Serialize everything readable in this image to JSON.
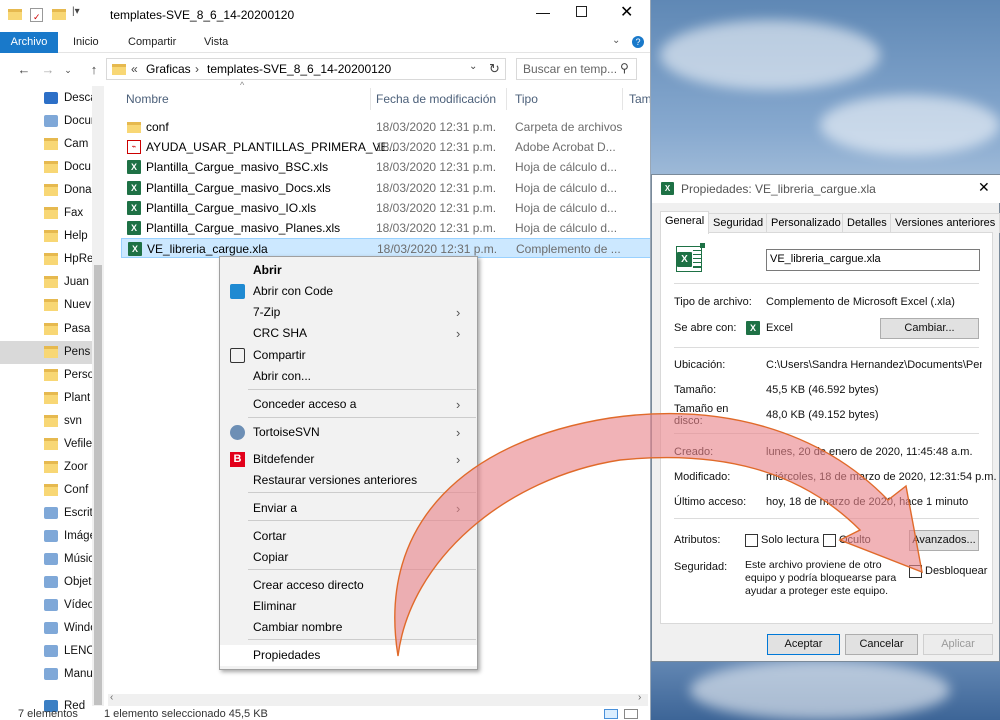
{
  "explorer": {
    "title": "templates-SVE_8_6_14-20200120",
    "ribbon_tabs": [
      "Archivo",
      "Inicio",
      "Compartir",
      "Vista"
    ],
    "breadcrumb": [
      "Graficas",
      "templates-SVE_8_6_14-20200120"
    ],
    "breadcrumb_overflow": "«",
    "search_placeholder": "Buscar en temp...",
    "columns": [
      "Nombre",
      "Fecha de modificación",
      "Tipo",
      "Tam"
    ],
    "nav_items": [
      "Descar",
      "Docum",
      "Cam",
      "Docu",
      "Dona",
      "Fax",
      "Help",
      "HpRe",
      "Juan",
      "Nuev",
      "Pasa",
      "Pens",
      "Perso",
      "Plant",
      "svn",
      "Vefile",
      "Zoor",
      "Conf",
      "Escrito",
      "Imáge",
      "Músic",
      "Objeto",
      "Vídeos",
      "Windo",
      "LENOV",
      "Manua",
      "Red"
    ],
    "files": [
      {
        "name": "conf",
        "date": "18/03/2020 12:31 p.m.",
        "type": "Carpeta de archivos",
        "icon": "folder-icon"
      },
      {
        "name": "AYUDA_USAR_PLANTILLAS_PRIMERA_VE...",
        "date": "18/03/2020 12:31 p.m.",
        "type": "Adobe Acrobat D...",
        "icon": "pdf-icon"
      },
      {
        "name": "Plantilla_Cargue_masivo_BSC.xls",
        "date": "18/03/2020 12:31 p.m.",
        "type": "Hoja de cálculo d...",
        "icon": "excel-icon"
      },
      {
        "name": "Plantilla_Cargue_masivo_Docs.xls",
        "date": "18/03/2020 12:31 p.m.",
        "type": "Hoja de cálculo d...",
        "icon": "excel-icon"
      },
      {
        "name": "Plantilla_Cargue_masivo_IO.xls",
        "date": "18/03/2020 12:31 p.m.",
        "type": "Hoja de cálculo d...",
        "icon": "excel-icon"
      },
      {
        "name": "Plantilla_Cargue_masivo_Planes.xls",
        "date": "18/03/2020 12:31 p.m.",
        "type": "Hoja de cálculo d...",
        "icon": "excel-icon"
      },
      {
        "name": "VE_libreria_cargue.xla",
        "date": "18/03/2020 12:31 p.m.",
        "type": "Complemento de ...",
        "icon": "excel-icon"
      }
    ],
    "status": {
      "count": "7 elementos",
      "selection": "1 elemento seleccionado  45,5 KB"
    }
  },
  "context_menu": [
    {
      "label": "Abrir",
      "bold": true
    },
    {
      "label": "Abrir con Code",
      "icon": "vscode-icon"
    },
    {
      "label": "7-Zip",
      "submenu": true
    },
    {
      "label": "CRC SHA",
      "submenu": true
    },
    {
      "label": "Compartir",
      "icon": "share-icon"
    },
    {
      "label": "Abrir con..."
    },
    {
      "label": "Conceder acceso a",
      "submenu": true
    },
    {
      "label": "TortoiseSVN",
      "submenu": true,
      "icon": "tortoise-icon"
    },
    {
      "label": "Bitdefender",
      "submenu": true,
      "icon": "bitdefender-icon"
    },
    {
      "label": "Restaurar versiones anteriores"
    },
    {
      "label": "Enviar a",
      "submenu": true
    },
    {
      "label": "Cortar"
    },
    {
      "label": "Copiar"
    },
    {
      "label": "Crear acceso directo"
    },
    {
      "label": "Eliminar"
    },
    {
      "label": "Cambiar nombre"
    },
    {
      "label": "Propiedades",
      "highlighted": true
    }
  ],
  "properties": {
    "title": "Propiedades: VE_libreria_cargue.xla",
    "tabs": [
      "General",
      "Seguridad",
      "Personalizado",
      "Detalles",
      "Versiones anteriores"
    ],
    "file_name": "VE_libreria_cargue.xla",
    "tipo_label": "Tipo de archivo:",
    "tipo_value": "Complemento de Microsoft Excel (.xla)",
    "abre_label": "Se abre con:",
    "abre_value": "Excel",
    "cambiar_button": "Cambiar...",
    "ubicacion_label": "Ubicación:",
    "ubicacion_value": "C:\\Users\\Sandra Hernandez\\Documents\\Pens",
    "tamano_label": "Tamaño:",
    "tamano_value": "45,5 KB (46.592 bytes)",
    "tamano_disco_label_1": "Tamaño en",
    "tamano_disco_label_2": "disco:",
    "tamano_disco_value": "48,0 KB (49.152 bytes)",
    "creado_label": "Creado:",
    "creado_value": "lunes, 20 de enero de 2020, 11:45:48 a.m.",
    "modificado_label": "Modificado:",
    "modificado_value": "miércoles, 18 de marzo de 2020, 12:31:54 p.m.",
    "acceso_label": "Último acceso:",
    "acceso_value": "hoy, 18 de marzo de 2020, hace 1 minuto",
    "atributos_label": "Atributos:",
    "solo_lectura": "Solo lectura",
    "oculto": "Oculto",
    "avanzados_button": "Avanzados...",
    "seguridad_label": "Seguridad:",
    "seguridad_text_1": "Este archivo proviene de otro",
    "seguridad_text_2": "equipo y podría bloquearse para",
    "seguridad_text_3": "ayudar a proteger este equipo.",
    "desbloquear": "Desbloquear",
    "aceptar": "Aceptar",
    "cancelar": "Cancelar",
    "aplicar": "Aplicar"
  },
  "colors": {
    "accent": "#1979ca",
    "selection": "#cce8ff",
    "arrow": "#e8848a",
    "arrow_stroke": "#e06a2a"
  }
}
